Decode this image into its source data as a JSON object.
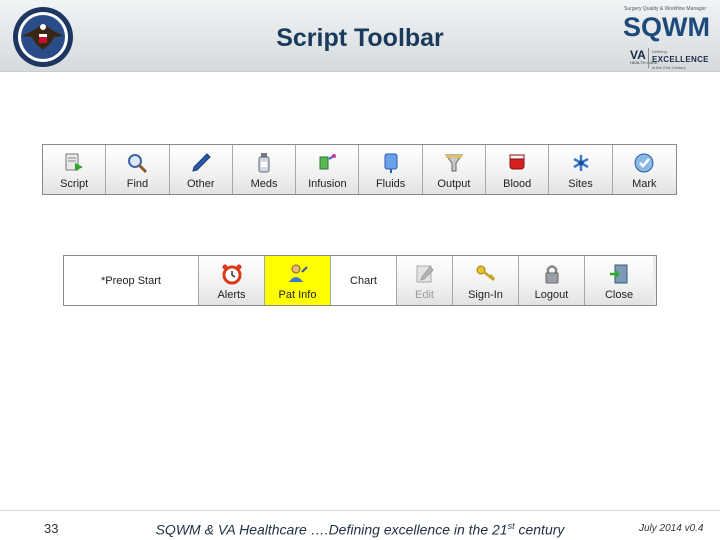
{
  "header": {
    "title": "Script Toolbar",
    "logo": {
      "tagline": "Surgery Quality & Workflow Manager",
      "name": "SQWM",
      "va": "VA",
      "va_care": "HEALTH CARE",
      "defining": "Defining",
      "excellence": "EXCELLENCE",
      "century": "in the 21st Century"
    }
  },
  "toolbar1": {
    "buttons": [
      {
        "label": "Script",
        "icon": "script-icon"
      },
      {
        "label": "Find",
        "icon": "magnifier-icon"
      },
      {
        "label": "Other",
        "icon": "pen-icon"
      },
      {
        "label": "Meds",
        "icon": "medicine-bottle-icon"
      },
      {
        "label": "Infusion",
        "icon": "infusion-icon"
      },
      {
        "label": "Fluids",
        "icon": "fluid-bag-icon"
      },
      {
        "label": "Output",
        "icon": "funnel-icon"
      },
      {
        "label": "Blood",
        "icon": "blood-bag-icon"
      },
      {
        "label": "Sites",
        "icon": "sites-icon"
      },
      {
        "label": "Mark",
        "icon": "mark-icon"
      }
    ]
  },
  "toolbar2": {
    "status": "*Preop Start",
    "chart_label": "Chart",
    "buttons": [
      {
        "label": "Alerts",
        "icon": "alarm-clock-icon"
      },
      {
        "label": "Pat Info",
        "icon": "patient-info-icon"
      },
      {
        "label": "Edit",
        "icon": "edit-icon"
      },
      {
        "label": "Sign-In",
        "icon": "keys-icon"
      },
      {
        "label": "Logout",
        "icon": "padlock-icon"
      },
      {
        "label": "Close",
        "icon": "exit-door-icon"
      }
    ]
  },
  "footer": {
    "page_number": "33",
    "text_main": "SQWM & VA Healthcare ….Defining excellence in the 21",
    "text_sup": "st",
    "text_end": " century",
    "date": "July 2014 v0.4"
  },
  "colors": {
    "title": "#1a3a5c",
    "highlight": "#ffff00",
    "header_band": "#d4dadd"
  }
}
